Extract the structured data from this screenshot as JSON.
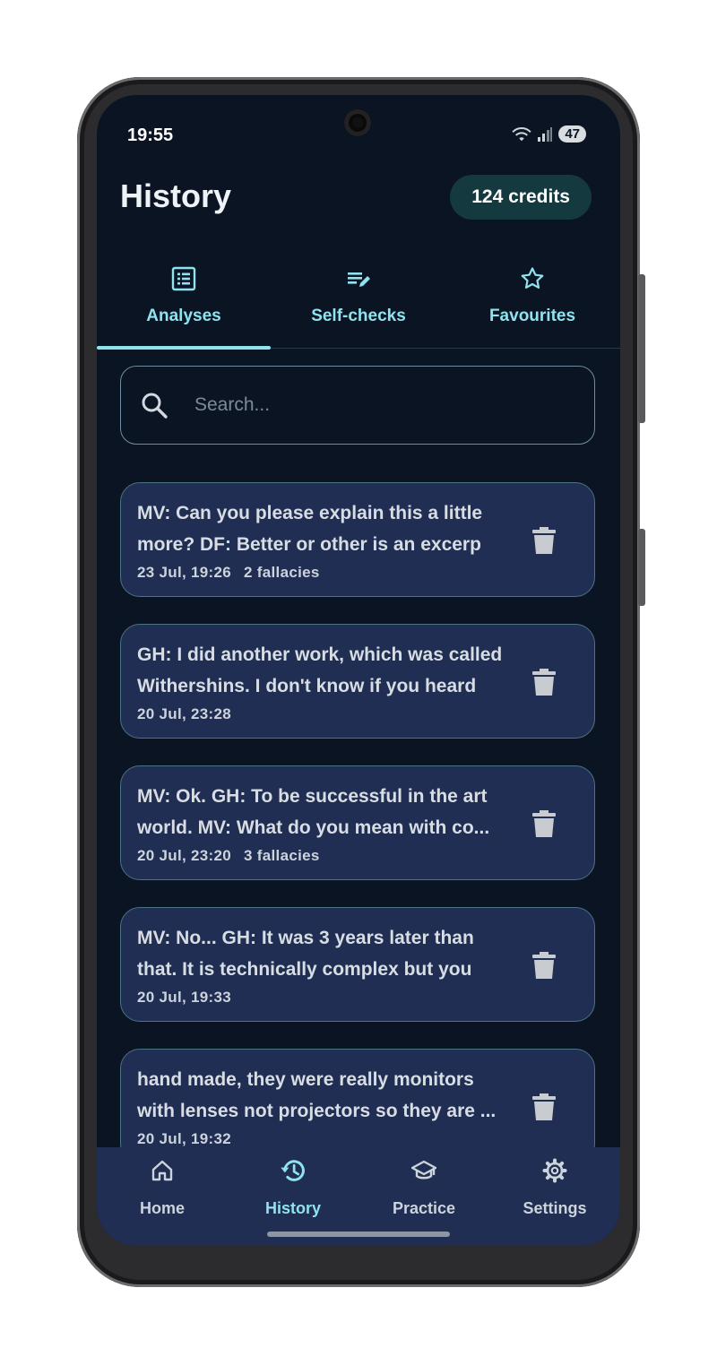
{
  "status": {
    "time": "19:55",
    "battery": "47"
  },
  "header": {
    "title": "History",
    "credits": "124 credits"
  },
  "tabs": [
    {
      "label": "Analyses",
      "icon": "list-alt-icon",
      "active": true
    },
    {
      "label": "Self-checks",
      "icon": "edit-note-icon",
      "active": false
    },
    {
      "label": "Favourites",
      "icon": "star-outline-icon",
      "active": false
    }
  ],
  "search": {
    "placeholder": "Search...",
    "value": ""
  },
  "entries": [
    {
      "line1": "MV: Can you please explain this a little",
      "line2": "more?  DF: Better or other is an excerp",
      "date": "23 Jul, 19:26",
      "fallacies": "2 fallacies"
    },
    {
      "line1": "GH: I did another work, which was called",
      "line2": "Withershins. I don't know if you heard",
      "date": "20 Jul, 23:28",
      "fallacies": ""
    },
    {
      "line1": "MV: Ok.  GH: To be successful in the art",
      "line2": "world.  MV: What do you mean with co...",
      "date": "20 Jul, 23:20",
      "fallacies": "3 fallacies"
    },
    {
      "line1": "MV: No... GH: It was 3 years later than",
      "line2": "that. It is technically complex but you",
      "date": "20 Jul, 19:33",
      "fallacies": ""
    },
    {
      "line1": "hand made, they were really monitors",
      "line2": "with lenses not projectors so they are ...",
      "date": "20 Jul, 19:32",
      "fallacies": ""
    }
  ],
  "bottom_nav": [
    {
      "label": "Home",
      "icon": "home-icon",
      "active": false
    },
    {
      "label": "History",
      "icon": "history-icon",
      "active": true
    },
    {
      "label": "Practice",
      "icon": "school-icon",
      "active": false
    },
    {
      "label": "Settings",
      "icon": "gear-icon",
      "active": false
    }
  ],
  "colors": {
    "background": "#0b1423",
    "card": "#1f2e52",
    "accent": "#8fe3ef",
    "credits_bg": "#14393e"
  }
}
